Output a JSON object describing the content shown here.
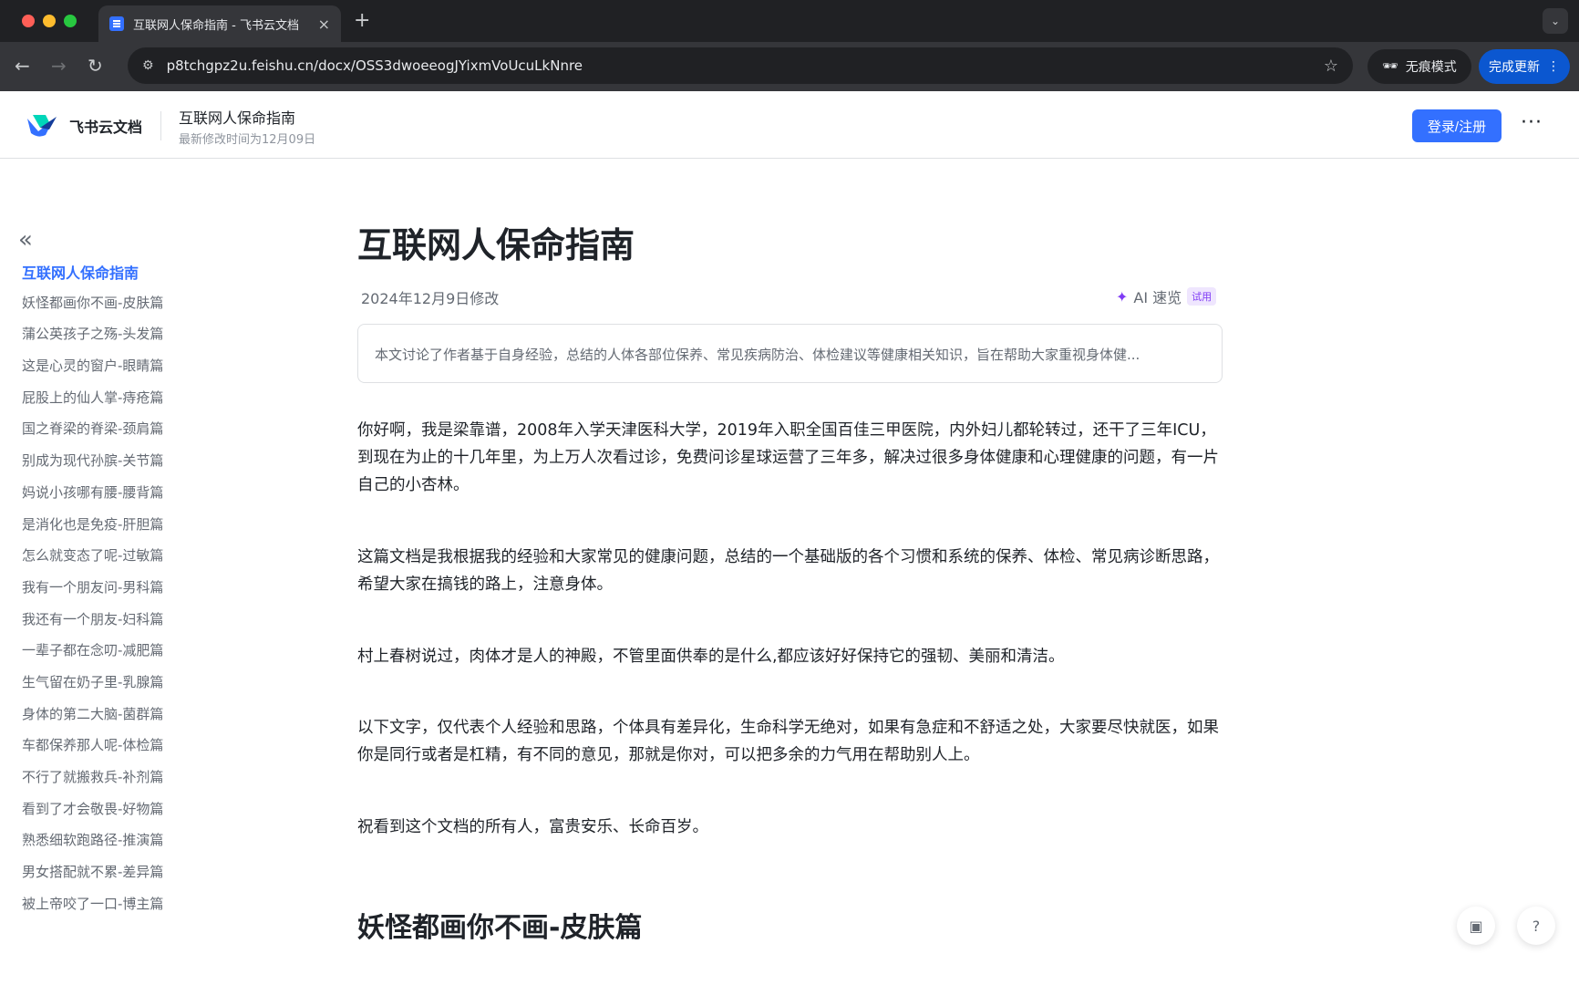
{
  "browser": {
    "tab_title": "互联网人保命指南 - 飞书云文档",
    "tab_close": "×",
    "new_tab": "+",
    "url": "p8tchgpz2u.feishu.cn/docx/OSS3dwoeeogJYixmVoUcuLkNnre",
    "incognito_label": "无痕模式",
    "update_label": "完成更新"
  },
  "header": {
    "brand": "飞书云文档",
    "doc_title": "互联网人保命指南",
    "doc_subtitle": "最新修改时间为12月09日",
    "login_label": "登录/注册",
    "more": "···"
  },
  "sidebar": {
    "collapse": "«",
    "items": [
      {
        "label": "互联网人保命指南"
      },
      {
        "label": "妖怪都画你不画-皮肤篇"
      },
      {
        "label": "蒲公英孩子之殇-头发篇"
      },
      {
        "label": "这是心灵的窗户-眼睛篇"
      },
      {
        "label": "屁股上的仙人掌-痔疮篇"
      },
      {
        "label": "国之脊梁的脊梁-颈肩篇"
      },
      {
        "label": "别成为现代孙膑-关节篇"
      },
      {
        "label": "妈说小孩哪有腰-腰背篇"
      },
      {
        "label": "是消化也是免疫-肝胆篇"
      },
      {
        "label": "怎么就变态了呢-过敏篇"
      },
      {
        "label": "我有一个朋友问-男科篇"
      },
      {
        "label": "我还有一个朋友-妇科篇"
      },
      {
        "label": "一辈子都在念叨-减肥篇"
      },
      {
        "label": "生气留在奶子里-乳腺篇"
      },
      {
        "label": "身体的第二大脑-菌群篇"
      },
      {
        "label": "车都保养那人呢-体检篇"
      },
      {
        "label": "不行了就搬救兵-补剂篇"
      },
      {
        "label": "看到了才会敬畏-好物篇"
      },
      {
        "label": "熟悉细软跑路径-推演篇"
      },
      {
        "label": "男女搭配就不累-差异篇"
      },
      {
        "label": "被上帝咬了一口-博主篇"
      }
    ]
  },
  "document": {
    "title": "互联网人保命指南",
    "modified": "2024年12月9日修改",
    "ai_label": "AI 速览",
    "ai_badge": "试用",
    "summary": "本文讨论了作者基于自身经验，总结的人体各部位保养、常见疾病防治、体检建议等健康相关知识，旨在帮助大家重视身体健...",
    "paragraphs": [
      "你好啊，我是梁靠谱，2008年入学天津医科大学，2019年入职全国百佳三甲医院，内外妇儿都轮转过，还干了三年ICU，到现在为止的十几年里，为上万人次看过诊，免费问诊星球运营了三年多，解决过很多身体健康和心理健康的问题，有一片自己的小杏林。",
      "这篇文档是我根据我的经验和大家常见的健康问题，总结的一个基础版的各个习惯和系统的保养、体检、常见病诊断思路，希望大家在搞钱的路上，注意身体。",
      "村上春树说过，肉体才是人的神殿，不管里面供奉的是什么,都应该好好保持它的强韧、美丽和清洁。",
      "以下文字，仅代表个人经验和思路，个体具有差异化，生命科学无绝对，如果有急症和不舒适之处，大家要尽快就医，如果你是同行或者是杠精，有不同的意见，那就是你对，可以把多余的力气用在帮助别人上。",
      "祝看到这个文档的所有人，富贵安乐、长命百岁。"
    ],
    "section_heading": "妖怪都画你不画-皮肤篇"
  },
  "icons": {
    "back": "back-arrow-icon",
    "forward": "forward-arrow-icon",
    "reload": "reload-icon",
    "site_info": "site-settings-icon",
    "bookmark": "star-icon",
    "incognito": "incognito-icon",
    "doc_tool": "document-tool-icon",
    "help": "help-icon"
  },
  "colors": {
    "accent": "#3370ff",
    "text": "#1f2329",
    "muted": "#646a73"
  }
}
